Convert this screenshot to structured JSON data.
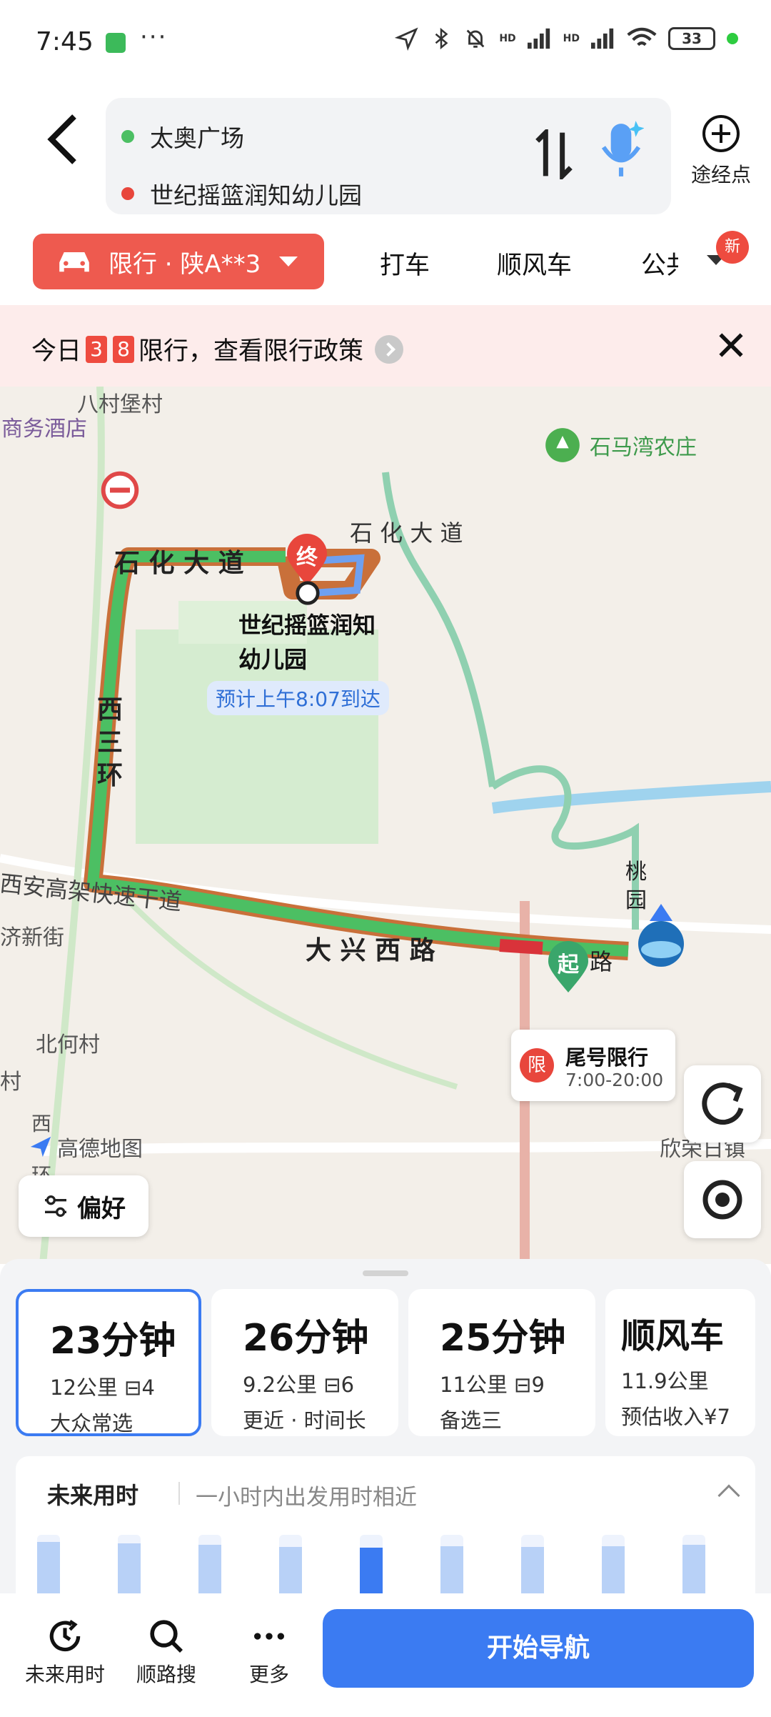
{
  "status_bar": {
    "time": "7:45",
    "dots": "···",
    "hd1": "HD",
    "hd2": "HD",
    "battery": "33"
  },
  "route": {
    "origin": "太奥广场",
    "destination": "世纪摇篮润知幼儿园",
    "via_label": "途经点"
  },
  "modes": {
    "car_chip": "限行 · 陕A**3",
    "taxi": "打车",
    "carpool": "顺风车",
    "transit": "公共",
    "new_badge": "新"
  },
  "notice": {
    "prefix": "今日",
    "num1": "3",
    "num2": "8",
    "suffix": "限行，查看限行政策"
  },
  "map": {
    "labels": {
      "hotel": "商务酒店",
      "village_top": "八村堡村",
      "farm": "石马湾农庄",
      "beihe": "北何村",
      "village_left": "村",
      "xin_street": "济新街",
      "right_area": "欣荣日镇"
    },
    "roads": {
      "shihua": "石 化 大 道",
      "shihua2": "石 化 大 道",
      "xisanhuan": "西\n三\n环",
      "expressway": "西安高架快速干道",
      "daxing": "大 兴 西 路",
      "taoyuan": "桃\n园",
      "lu": "路"
    },
    "end_marker": "终",
    "start_marker": "起",
    "dest_name": "世纪摇篮润知\n幼儿园",
    "eta": "预计上午8:07到达",
    "restriction": {
      "badge": "限",
      "title": "尾号限行",
      "hours": "7:00-20:00"
    },
    "logo": "高德地图",
    "logo_prefix": "西",
    "logo_suffix": "环",
    "pref_button": "偏好"
  },
  "routes": [
    {
      "time": "23分钟",
      "dist": "12公里",
      "lights": "4",
      "tag": "大众常选",
      "selected": true
    },
    {
      "time": "26分钟",
      "dist": "9.2公里",
      "lights": "6",
      "tag": "更近 · 时间长",
      "selected": false
    },
    {
      "time": "25分钟",
      "dist": "11公里",
      "lights": "9",
      "tag": "备选三",
      "selected": false
    },
    {
      "time": "顺风车",
      "dist": "11.9公里",
      "lights": "",
      "tag": "预估收入¥7",
      "selected": false
    }
  ],
  "future": {
    "title": "未来用时",
    "subtitle": "一小时内出发用时相近",
    "bars": [
      0.92,
      0.9,
      0.88,
      0.86,
      0.85,
      0.87,
      0.86,
      0.87,
      0.88
    ],
    "current_index": 4
  },
  "bottom_nav": {
    "future": "未来用时",
    "search": "顺路搜",
    "more": "更多",
    "start": "开始导航"
  },
  "colors": {
    "accent": "#3b7bf2",
    "restriction": "#ee5a4f",
    "route_green": "#4cbf63",
    "route_outline": "#c9703a"
  }
}
